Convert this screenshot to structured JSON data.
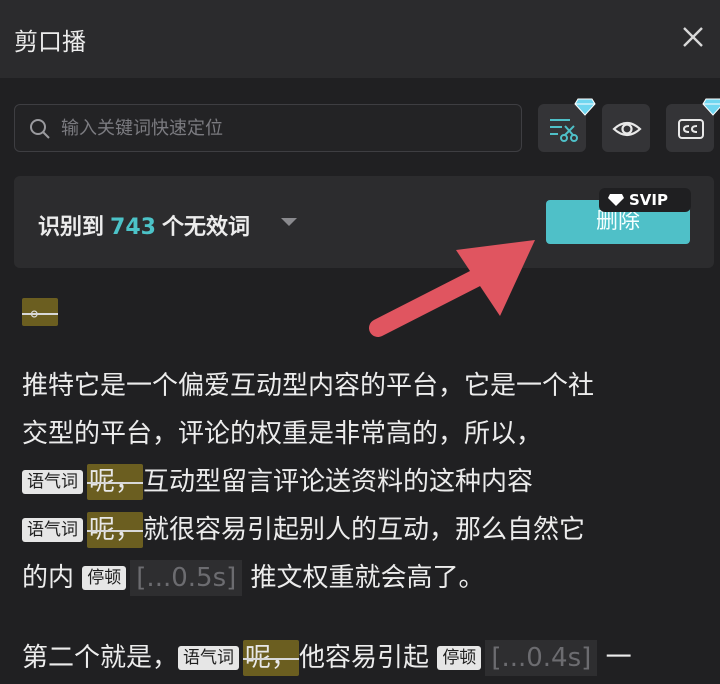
{
  "window": {
    "title": "剪口播"
  },
  "search": {
    "placeholder": "输入关键词快速定位"
  },
  "summary": {
    "prefix": "识别到",
    "count": "743",
    "suffix": "个无效词"
  },
  "actions": {
    "delete_label": "删除",
    "badge": "SVIP"
  },
  "transcript": {
    "tag_modal": "语气词",
    "tag_pause": "停顿",
    "filler_ne": "呢，",
    "first_punct": "。",
    "line1": "推特它是一个偏爱互动型内容的平台，它是一个社",
    "line2": "交型的平台，评论的权重是非常高的，所以，",
    "line3_text": "互动型留言评论送资料的这种内容",
    "line4_text": "就很容易引起别人的互动，那么自然它",
    "line5_pre": "的内",
    "pause1": "[...0.5s]",
    "line5_post": "推文权重就会高了。",
    "line6_pre": "第二个就是，",
    "line6_mid": "他容易引起",
    "pause2": "[...0.4s]",
    "line6_post": "一"
  },
  "colors": {
    "accent": "#4fc0c8",
    "filler_highlight": "#6b5e20",
    "arrow": "#e05560"
  }
}
